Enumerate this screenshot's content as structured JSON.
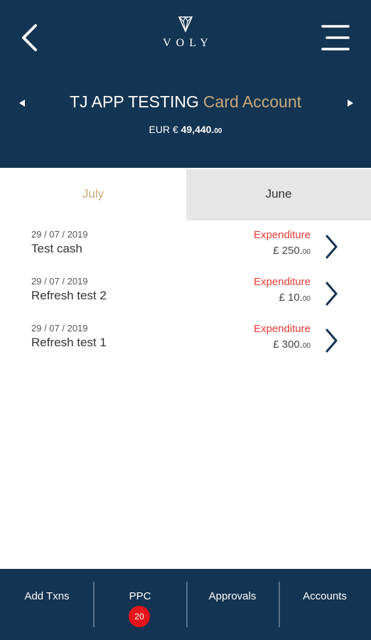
{
  "header": {
    "logo_text": "VOLY",
    "account_name": "TJ APP TESTING",
    "account_type": "Card Account",
    "balance_prefix": "EUR €",
    "balance_amount": "49,440.",
    "balance_decimals": "00"
  },
  "icons": {
    "back": "back-arrow-icon",
    "menu": "hamburger-menu-icon",
    "logo": "voly-diamond-logo",
    "prev": "left-triangle-icon",
    "next": "right-triangle-icon",
    "row_chevron": "chevron-right-icon"
  },
  "tabs": [
    {
      "label": "July",
      "active": true
    },
    {
      "label": "June",
      "active": false
    }
  ],
  "transactions": [
    {
      "date": "29 / 07 / 2019",
      "description": "Test cash",
      "type": "Expenditure",
      "amount": "£ 250.",
      "decimals": "00"
    },
    {
      "date": "29 / 07 / 2019",
      "description": "Refresh test 2",
      "type": "Expenditure",
      "amount": "£ 10.",
      "decimals": "00"
    },
    {
      "date": "29 / 07 / 2019",
      "description": "Refresh test 1",
      "type": "Expenditure",
      "amount": "£ 300.",
      "decimals": "00"
    }
  ],
  "footer": {
    "add_txns": "Add Txns",
    "ppc": "PPC",
    "ppc_badge": "20",
    "approvals": "Approvals",
    "accounts": "Accounts"
  },
  "colors": {
    "navy": "#133452",
    "gold": "#c9a978",
    "expenditure_red": "#e53935",
    "badge_red": "#e4151b",
    "inactive_tab": "#e6e6e6"
  }
}
